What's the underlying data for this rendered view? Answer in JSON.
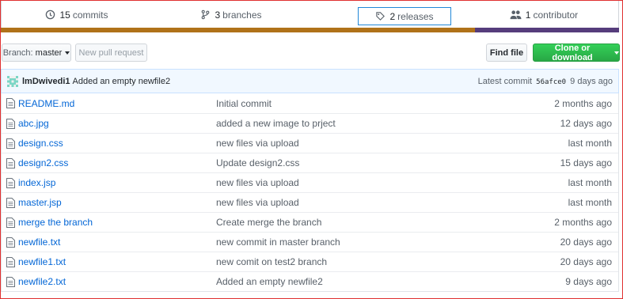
{
  "stats": {
    "commits_count": "15",
    "commits_label": "commits",
    "branches_count": "3",
    "branches_label": "branches",
    "releases_count": "2",
    "releases_label": "releases",
    "contributors_count": "1",
    "contributors_label": "contributor"
  },
  "colors": {
    "language_bar_primary": "#b07219",
    "language_bar_secondary": "#563d7c",
    "link": "#0366d6",
    "clone_button": "#28a745"
  },
  "toolbar": {
    "branch_label": "Branch:",
    "branch_value": "master",
    "new_pr_label": "New pull request",
    "find_file_label": "Find file",
    "clone_label": "Clone or download"
  },
  "latest_commit": {
    "author": "lmDwivedi1",
    "message": "Added an empty newfile2",
    "prefix": "Latest commit",
    "sha": "56afce0",
    "age": "9 days ago"
  },
  "files": [
    {
      "name": "README.md",
      "message": "Initial commit",
      "age": "2 months ago",
      "icon": "file-icon"
    },
    {
      "name": "abc.jpg",
      "message": "added a new image to prject",
      "age": "12 days ago",
      "icon": "file-icon"
    },
    {
      "name": "design.css",
      "message": "new files via upload",
      "age": "last month",
      "icon": "file-icon"
    },
    {
      "name": "design2.css",
      "message": "Update design2.css",
      "age": "15 days ago",
      "icon": "file-icon"
    },
    {
      "name": "index.jsp",
      "message": "new files via upload",
      "age": "last month",
      "icon": "file-icon"
    },
    {
      "name": "master.jsp",
      "message": "new files via upload",
      "age": "last month",
      "icon": "file-icon"
    },
    {
      "name": "merge the branch",
      "message": "Create merge the branch",
      "age": "2 months ago",
      "icon": "file-icon"
    },
    {
      "name": "newfile.txt",
      "message": "new commit in master branch",
      "age": "20 days ago",
      "icon": "file-icon"
    },
    {
      "name": "newfile1.txt",
      "message": "new comit on test2 branch",
      "age": "20 days ago",
      "icon": "file-icon"
    },
    {
      "name": "newfile2.txt",
      "message": "Added an empty newfile2",
      "age": "9 days ago",
      "icon": "file-icon"
    }
  ]
}
